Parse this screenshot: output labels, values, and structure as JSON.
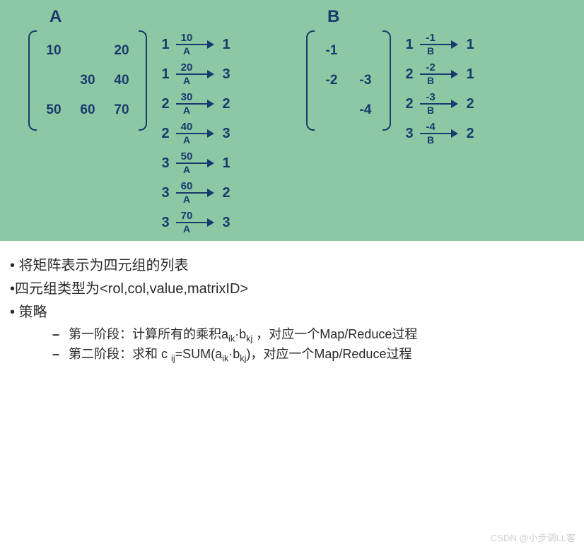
{
  "matrixA": {
    "title": "A",
    "label": "A",
    "cells": [
      [
        "10",
        "",
        "20"
      ],
      [
        "",
        "30",
        "40"
      ],
      [
        "50",
        "60",
        "70"
      ]
    ],
    "mappings": [
      {
        "src": "1",
        "val": "10",
        "dst": "1"
      },
      {
        "src": "1",
        "val": "20",
        "dst": "3"
      },
      {
        "src": "2",
        "val": "30",
        "dst": "2"
      },
      {
        "src": "2",
        "val": "40",
        "dst": "3"
      },
      {
        "src": "3",
        "val": "50",
        "dst": "1"
      },
      {
        "src": "3",
        "val": "60",
        "dst": "2"
      },
      {
        "src": "3",
        "val": "70",
        "dst": "3"
      }
    ]
  },
  "matrixB": {
    "title": "B",
    "label": "B",
    "cells": [
      [
        "-1",
        ""
      ],
      [
        "-2",
        "-3"
      ],
      [
        "",
        "-4"
      ]
    ],
    "mappings": [
      {
        "src": "1",
        "val": "-1",
        "dst": "1"
      },
      {
        "src": "2",
        "val": "-2",
        "dst": "1"
      },
      {
        "src": "2",
        "val": "-3",
        "dst": "2"
      },
      {
        "src": "3",
        "val": "-4",
        "dst": "2"
      }
    ]
  },
  "notes": {
    "b1": "将矩阵表示为四元组的列表",
    "b2": "四元组类型为<rol,col,value,matrixID>",
    "b3": "策略",
    "s1_pre": "第一阶段：计算所有的乘积a",
    "s1_sub1": "ik",
    "s1_mid": "·b",
    "s1_sub2": "kj",
    "s1_post": " ，对应一个Map/Reduce过程",
    "s2_pre": "第二阶段：求和 c ",
    "s2_sub0": "ij",
    "s2_mid1": "=SUM(a",
    "s2_sub1": "ik",
    "s2_mid2": "·b",
    "s2_sub2": "kj",
    "s2_post": ")，对应一个Map/Reduce过程"
  },
  "watermark": "CSDN @小步调LL客"
}
